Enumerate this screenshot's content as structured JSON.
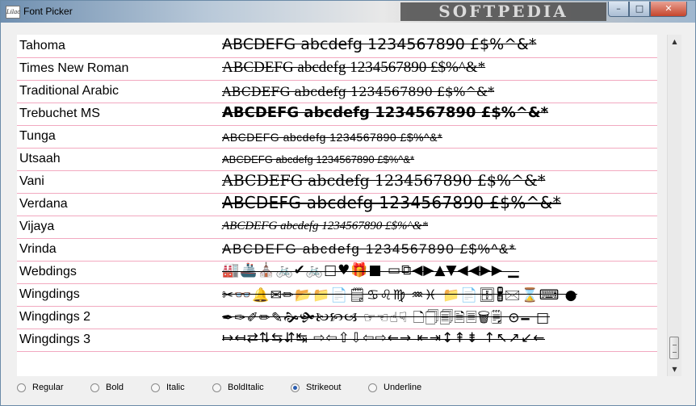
{
  "window": {
    "title": "Font Picker",
    "app_icon_text": "Lilac",
    "watermark": "SOFTPEDIA",
    "buttons": {
      "minimize": "–",
      "maximize": "□",
      "close": "✕"
    }
  },
  "fonts": [
    {
      "name": "Tahoma",
      "sample": "ABCDEFG abcdefg 1234567890 £$%^&*"
    },
    {
      "name": "Times New Roman",
      "sample": "ABCDEFG abcdefg 1234567890 £$%^&*"
    },
    {
      "name": "Traditional Arabic",
      "sample": "ABCDEFG abcdefg 1234567890 £$%^&*"
    },
    {
      "name": "Trebuchet MS",
      "sample": "ABCDEFG abcdefg 1234567890 £$%^&*"
    },
    {
      "name": "Tunga",
      "sample": "ABCDEFG abcdefg 1234567890 £$%^&*"
    },
    {
      "name": "Utsaah",
      "sample": "ABCDEFG abcdefg 1234567890 £$%^&*"
    },
    {
      "name": "Vani",
      "sample": "ABCDEFG abcdefg 1234567890 £$%^&*"
    },
    {
      "name": "Verdana",
      "sample": "ABCDEFG abcdefg 1234567890 £$%^&*"
    },
    {
      "name": "Vijaya",
      "sample": "ABCDEFG abcdefg 1234567890 £$%^&*"
    },
    {
      "name": "Vrinda",
      "sample": "ABCDEFG abcdefg 1234567890 £$%^&*"
    },
    {
      "name": "Webdings",
      "symbols": "🏭🚢⛪🚲✔🚲□♥🎁■ ▭⧉◀▶▲▼◀◀▶▶ ▁"
    },
    {
      "name": "Wingdings",
      "symbols": "✂👓🔔✉✏📂📁📄🗒♋♌♍ ♒♓ 📁📄🗄🖁🖂⌛⌨ ●"
    },
    {
      "name": "Wingdings 2",
      "symbols": "✒✑✐✏✎🙞🙟🙠🙡🙢 ☞☜☝☟ 🗋🗍🗐🗎🗏🗑🗒 ⊙🗕 □"
    },
    {
      "name": "Wingdings 3",
      "symbols": "↦↤⇄⇅⇆⇵↹ ⇨⇦⇧⇩⇦⇨←→ ⇤⇥↕⇞⇟ ↑↖↗↙←"
    }
  ],
  "styles": {
    "options": [
      "Regular",
      "Bold",
      "Italic",
      "BoldItalic",
      "Strikeout",
      "Underline"
    ],
    "selected": "Strikeout"
  }
}
